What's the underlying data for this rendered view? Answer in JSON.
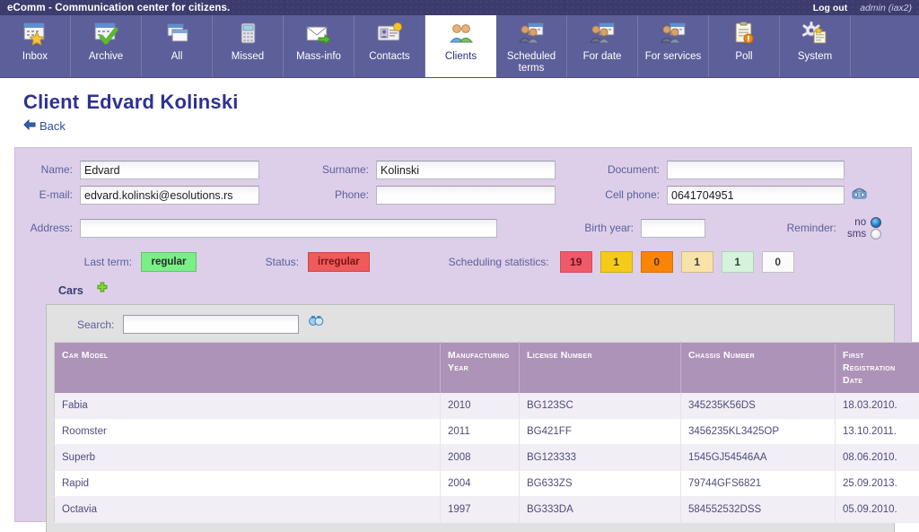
{
  "titlebar": {
    "app_title": "eComm - Communication center for citizens.",
    "logout_label": "Log out",
    "user_label": "admin (iax2)"
  },
  "nav": {
    "items": [
      {
        "label": "Inbox",
        "icon": "calendar-star-icon",
        "active": false
      },
      {
        "label": "Archive",
        "icon": "calendar-check-icon",
        "active": false
      },
      {
        "label": "All",
        "icon": "windows-stack-icon",
        "active": false
      },
      {
        "label": "Missed",
        "icon": "telephone-icon",
        "active": false
      },
      {
        "label": "Mass-info",
        "icon": "envelope-arrow-icon",
        "active": false
      },
      {
        "label": "Contacts",
        "icon": "id-card-icon",
        "active": false
      },
      {
        "label": "Clients",
        "icon": "people-icon",
        "active": true
      },
      {
        "label": "Scheduled terms",
        "icon": "people-calendar-icon",
        "active": false
      },
      {
        "label": "For date",
        "icon": "people-calendar-icon",
        "active": false
      },
      {
        "label": "For services",
        "icon": "people-calendar-icon",
        "active": false
      },
      {
        "label": "Poll",
        "icon": "clipboard-pin-icon",
        "active": false
      },
      {
        "label": "System",
        "icon": "gear-note-icon",
        "active": false
      }
    ]
  },
  "page": {
    "title_prefix": "Client",
    "client_name": "Edvard Kolinski",
    "back_label": "Back"
  },
  "form": {
    "name_label": "Name:",
    "name_value": "Edvard",
    "surname_label": "Surname:",
    "surname_value": "Kolinski",
    "document_label": "Document:",
    "document_value": "",
    "email_label": "E-mail:",
    "email_value": "edvard.kolinski@esolutions.rs",
    "phone_label": "Phone:",
    "phone_value": "",
    "cell_phone_label": "Cell phone:",
    "cell_phone_value": "0641704951",
    "address_label": "Address:",
    "address_value": "",
    "birth_year_label": "Birth year:",
    "birth_year_value": "",
    "reminder_label": "Reminder:",
    "reminder_options": [
      {
        "label": "no",
        "selected": true
      },
      {
        "label": "sms",
        "selected": false
      }
    ]
  },
  "status": {
    "last_term_label": "Last term:",
    "last_term_value": "regular",
    "status_label": "Status:",
    "status_value": "irregular",
    "scheduling_statistics_label": "Scheduling statistics:",
    "scheduling_statistics": [
      {
        "value": "19",
        "color": "#ef5a6a"
      },
      {
        "value": "1",
        "color": "#f5cb19"
      },
      {
        "value": "0",
        "color": "#f98506"
      },
      {
        "value": "1",
        "color": "#f7e3a8"
      },
      {
        "value": "1",
        "color": "#d5f3dc"
      },
      {
        "value": "0",
        "color": "#fbfbfb"
      }
    ]
  },
  "cars": {
    "section_title": "Cars",
    "add_icon": "plus-icon",
    "search_label": "Search:",
    "search_value": "",
    "search_placeholder": "",
    "columns": [
      "Car model",
      "Manufacturing year",
      "License number",
      "Chassis number",
      "First registration date"
    ],
    "rows": [
      {
        "model": "Fabia",
        "year": "2010",
        "license": "BG123SC",
        "chassis": "345235K56DS",
        "first_registration": "18.03.2010."
      },
      {
        "model": "Roomster",
        "year": "2011",
        "license": "BG421FF",
        "chassis": "3456235KL3425OP",
        "first_registration": "13.10.2011."
      },
      {
        "model": "Superb",
        "year": "2008",
        "license": "BG123333",
        "chassis": "1545GJ54546AA",
        "first_registration": "08.06.2010."
      },
      {
        "model": "Rapid",
        "year": "2004",
        "license": "BG633ZS",
        "chassis": "79744GFS6821",
        "first_registration": "25.09.2013."
      },
      {
        "model": "Octavia",
        "year": "1997",
        "license": "BG333DA",
        "chassis": "584552532DSS",
        "first_registration": "05.09.2010."
      }
    ]
  },
  "colors": {
    "titlebar": "#3b3b6d",
    "nav": "#5c5f99",
    "panel": "#ddcfe9",
    "table_header": "#ad93b8",
    "accent_title": "#2e3192"
  }
}
